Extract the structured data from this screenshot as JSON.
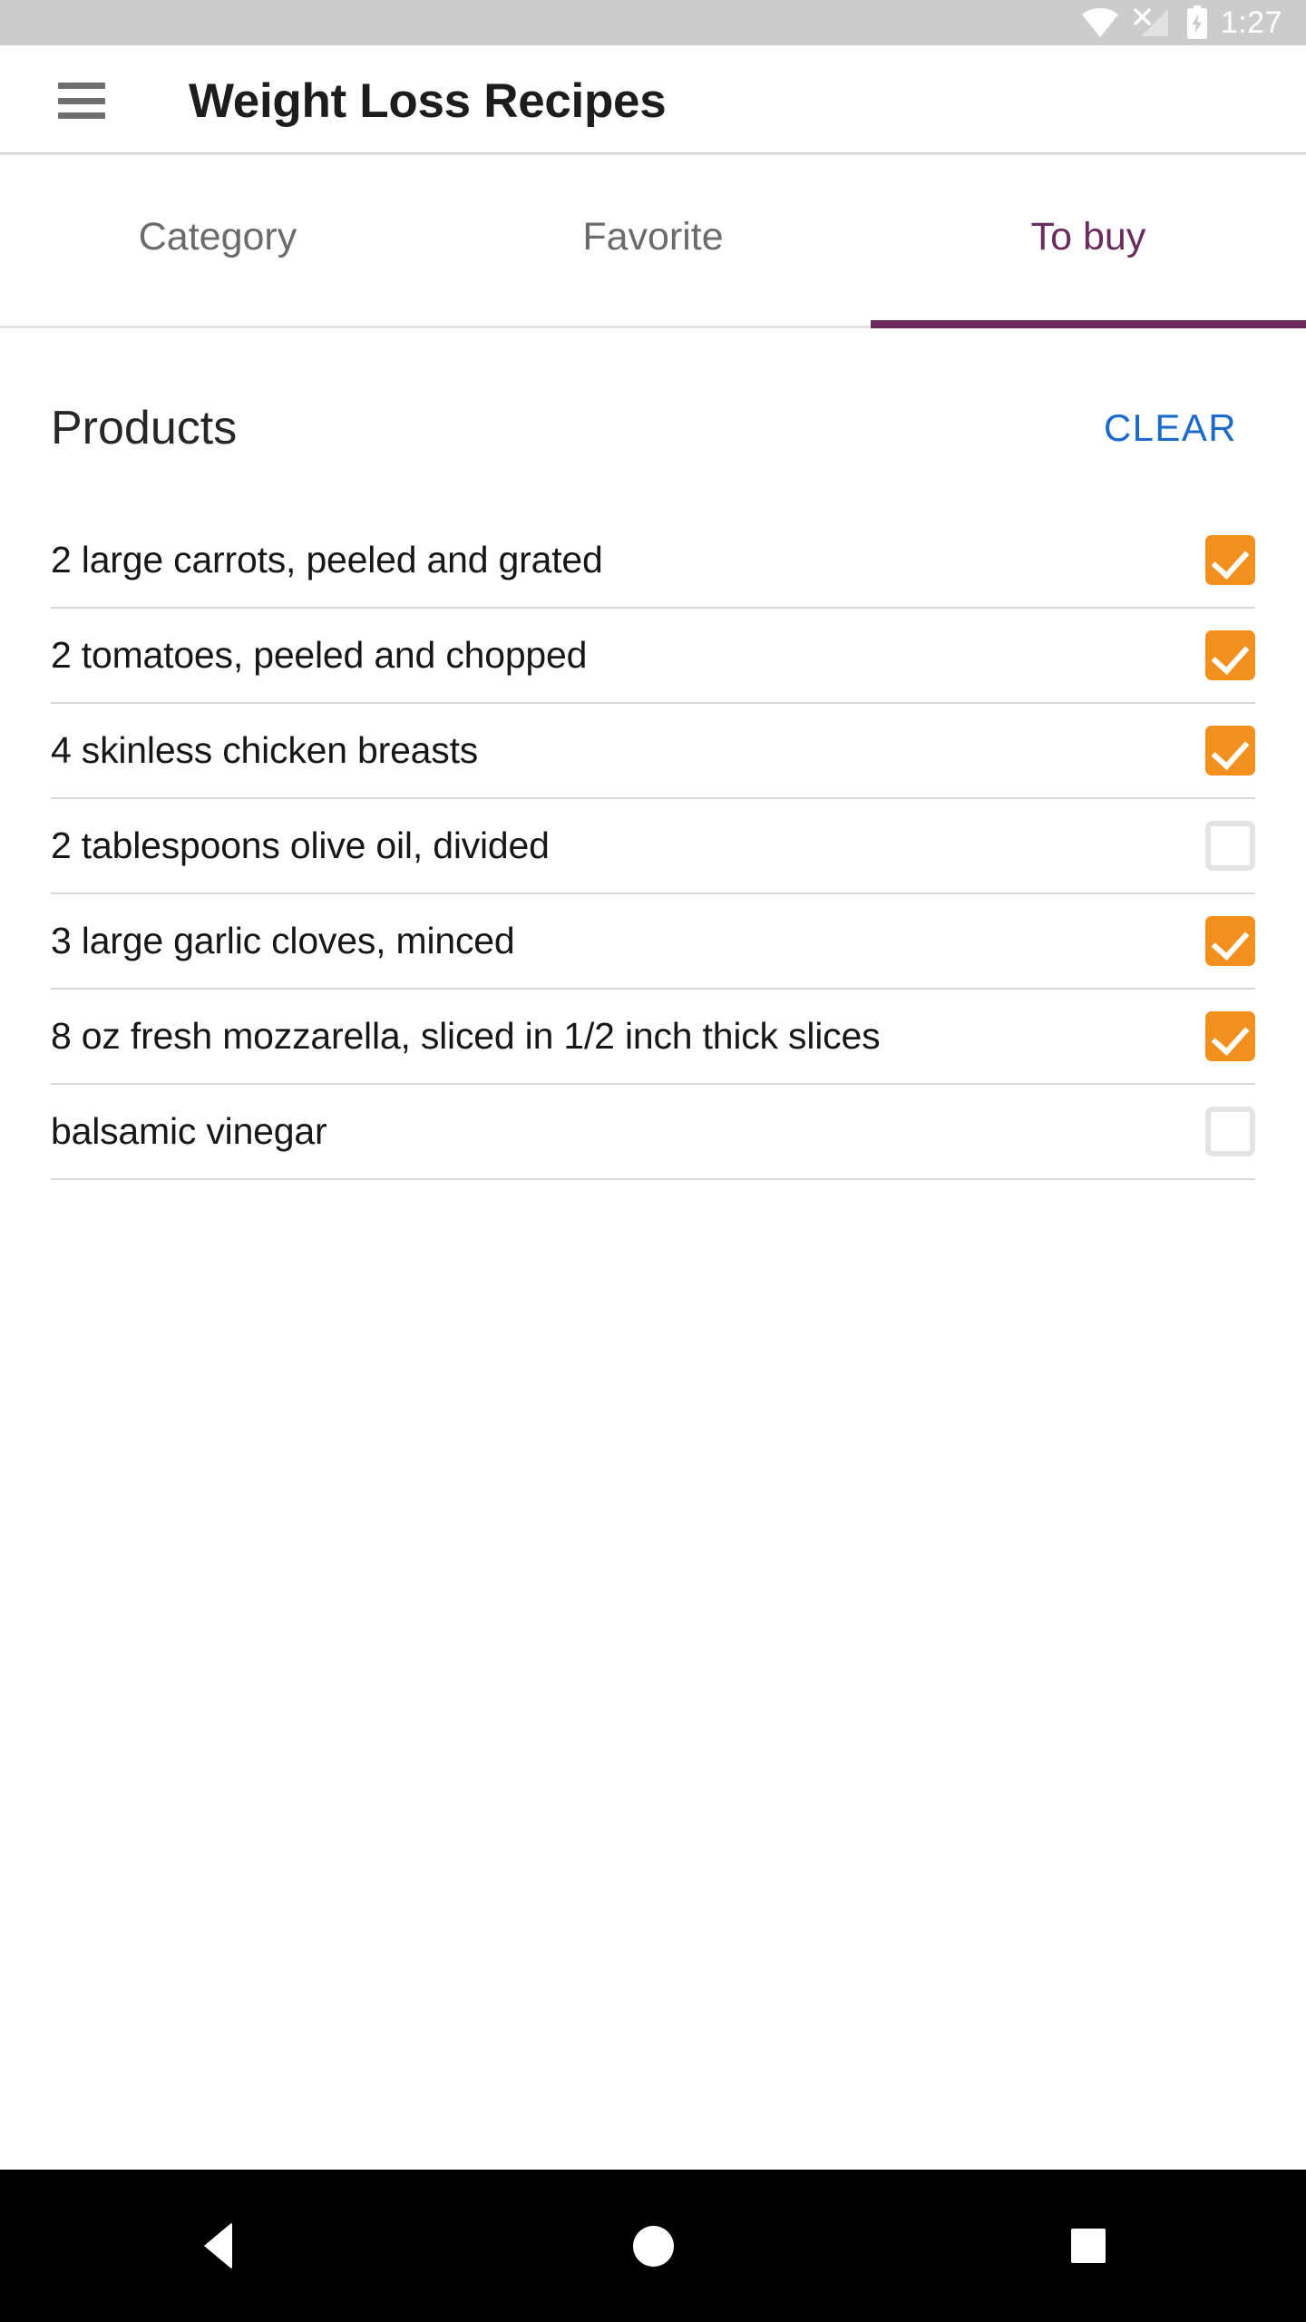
{
  "status_bar": {
    "time": "1:27",
    "icons": [
      "wifi-icon",
      "cellular-no-signal-icon",
      "battery-charging-icon"
    ],
    "background_color": "#cccccc"
  },
  "app_bar": {
    "menu_icon": "hamburger-menu-icon",
    "title": "Weight Loss Recipes"
  },
  "tabs": {
    "active_index": 2,
    "accent_color": "#6a2c5e",
    "items": [
      {
        "label": "Category",
        "active": false
      },
      {
        "label": "Favorite",
        "active": false
      },
      {
        "label": "To buy",
        "active": true
      }
    ]
  },
  "section": {
    "title": "Products",
    "clear_label": "CLEAR",
    "clear_color": "#1b6ac9"
  },
  "checkbox": {
    "checked_color": "#f3901d",
    "unchecked_border_color": "#e3e3e3",
    "check_glyph": "check-icon"
  },
  "products": [
    {
      "label": "2 large carrots, peeled and grated",
      "checked": true
    },
    {
      "label": "2 tomatoes, peeled and chopped",
      "checked": true
    },
    {
      "label": "4 skinless chicken breasts",
      "checked": true
    },
    {
      "label": "2 tablespoons olive oil, divided",
      "checked": false
    },
    {
      "label": "3 large garlic cloves, minced",
      "checked": true
    },
    {
      "label": "8 oz fresh mozzarella, sliced in 1/2 inch thick slices",
      "checked": true
    },
    {
      "label": "balsamic vinegar",
      "checked": false
    }
  ],
  "nav_bar": {
    "background_color": "#000000",
    "buttons": [
      {
        "name": "back-button",
        "icon": "triangle-back-icon"
      },
      {
        "name": "home-button",
        "icon": "circle-home-icon"
      },
      {
        "name": "recents-button",
        "icon": "square-recents-icon"
      }
    ]
  }
}
